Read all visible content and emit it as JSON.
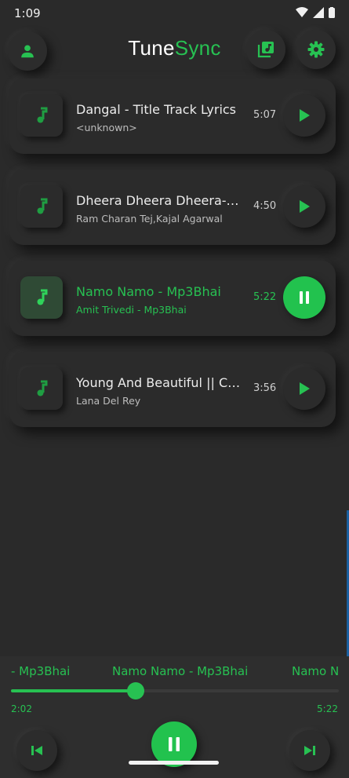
{
  "status": {
    "time": "1:09"
  },
  "app": {
    "title_part1": "Tune",
    "title_part2": "Sync"
  },
  "icons": {
    "profile": "person-icon",
    "library": "music-library-icon",
    "settings": "gear-icon",
    "note": "music-note-icon",
    "play": "play-icon",
    "pause": "pause-icon",
    "prev": "skip-previous-icon",
    "next": "skip-next-icon"
  },
  "songs": [
    {
      "title": "Dangal - Title Track  Lyrics",
      "artist": "<unknown>",
      "duration": "5:07",
      "active": false
    },
    {
      "title": "Dheera Dheera Dheera-Song",
      "artist": "Ram Charan Tej,Kajal Agarwal",
      "duration": "4:50",
      "active": false
    },
    {
      "title": "Namo Namo - Mp3Bhai",
      "artist": "Amit Trivedi - Mp3Bhai",
      "duration": "5:22",
      "active": true
    },
    {
      "title": "Young And Beautiful || Cover",
      "artist": "Lana Del Rey",
      "duration": "3:56",
      "active": false
    }
  ],
  "player": {
    "marquee_prev": "- Mp3Bhai",
    "marquee_main": "Namo Namo - Mp3Bhai",
    "marquee_next": "Namo N",
    "current_time": "2:02",
    "total_time": "5:22",
    "progress": 0.38
  },
  "colors": {
    "accent": "#27c152",
    "background": "#2a2a2a"
  }
}
